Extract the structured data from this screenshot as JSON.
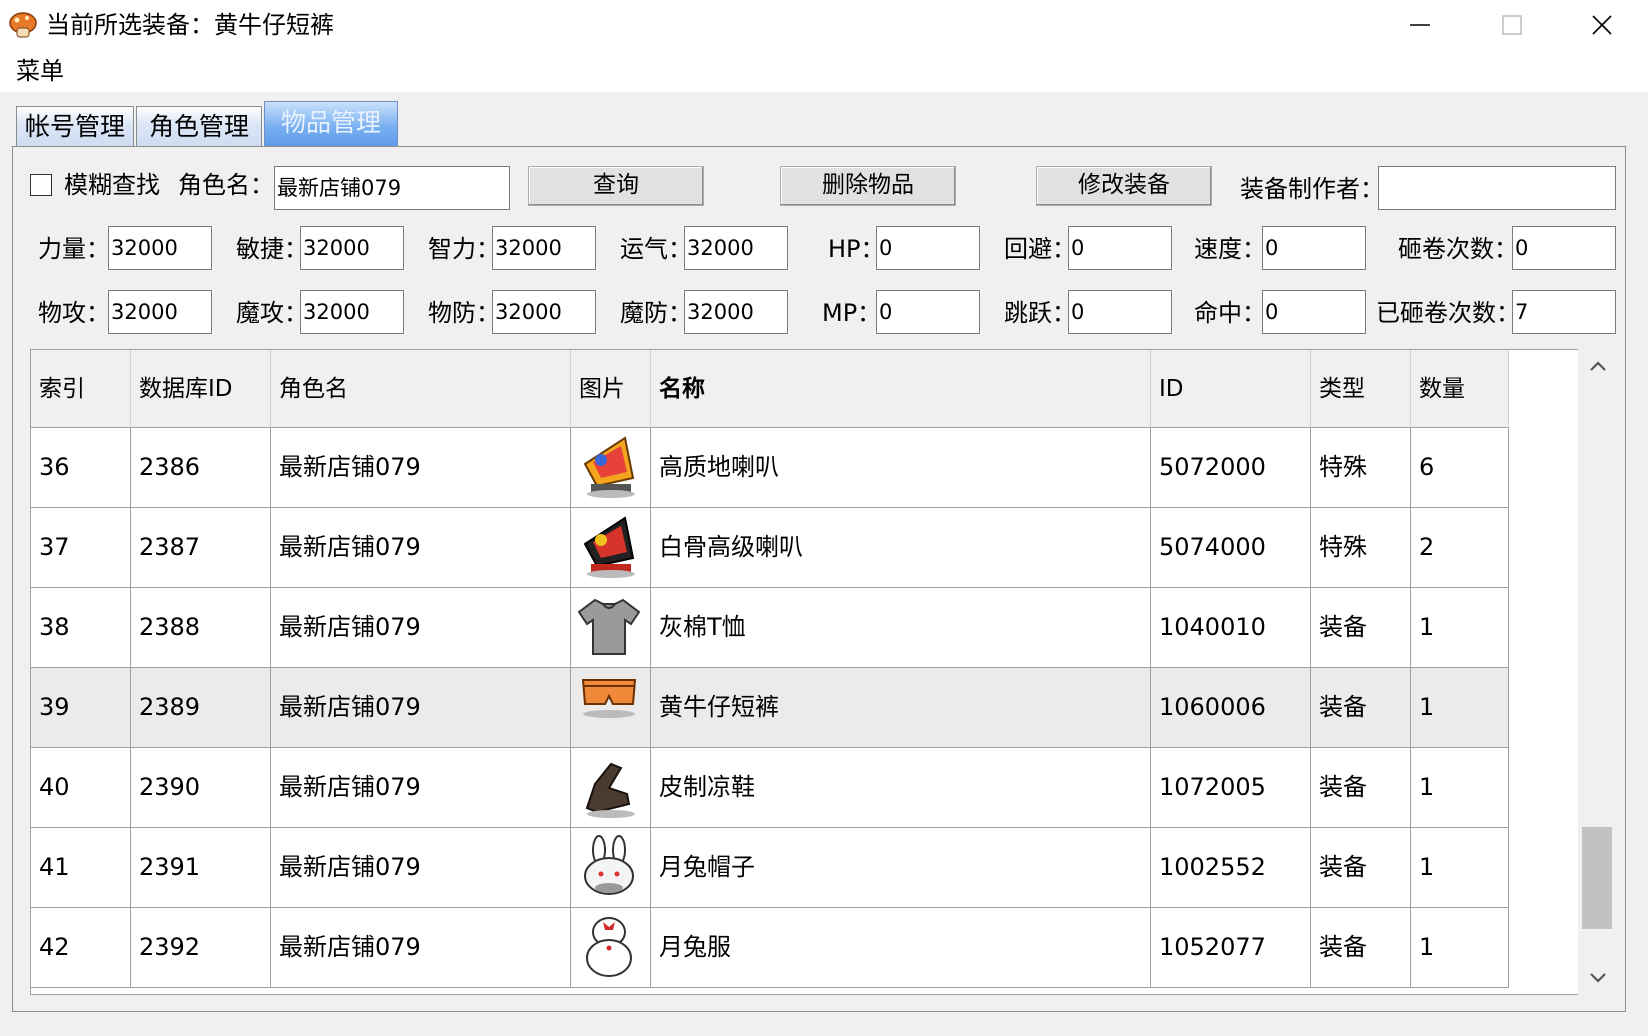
{
  "window": {
    "title": "当前所选装备：黄牛仔短裤",
    "menu": "菜单"
  },
  "tabs": [
    {
      "label": "帐号管理",
      "active": false
    },
    {
      "label": "角色管理",
      "active": false
    },
    {
      "label": "物品管理",
      "active": true
    }
  ],
  "search": {
    "fuzzy_label": "模糊查找",
    "fuzzy_checked": false,
    "role_label": "角色名：",
    "role_value": "最新店铺079",
    "query_button": "查询",
    "delete_button": "删除物品",
    "modify_button": "修改装备",
    "maker_label": "装备制作者：",
    "maker_value": ""
  },
  "stats": {
    "str": {
      "label": "力量：",
      "value": "32000"
    },
    "dex": {
      "label": "敏捷：",
      "value": "32000"
    },
    "int": {
      "label": "智力：",
      "value": "32000"
    },
    "luk": {
      "label": "运气：",
      "value": "32000"
    },
    "hp": {
      "label": "HP：",
      "value": "0"
    },
    "avoid": {
      "label": "回避：",
      "value": "0"
    },
    "speed": {
      "label": "速度：",
      "value": "0"
    },
    "scroll_slots": {
      "label": "砸卷次数：",
      "value": "0"
    },
    "watk": {
      "label": "物攻：",
      "value": "32000"
    },
    "matk": {
      "label": "魔攻：",
      "value": "32000"
    },
    "wdef": {
      "label": "物防：",
      "value": "32000"
    },
    "mdef": {
      "label": "魔防：",
      "value": "32000"
    },
    "mp": {
      "label": "MP：",
      "value": "0"
    },
    "jump": {
      "label": "跳跃：",
      "value": "0"
    },
    "acc": {
      "label": "命中：",
      "value": "0"
    },
    "scrolled": {
      "label": "已砸卷次数：",
      "value": "7"
    }
  },
  "table": {
    "columns": [
      "索引",
      "数据库ID",
      "角色名",
      "图片",
      "名称",
      "ID",
      "类型",
      "数量"
    ],
    "rows": [
      {
        "index": "36",
        "dbid": "2386",
        "role": "最新店铺079",
        "icon": "megaphone-gold-icon",
        "name": "高质地喇叭",
        "id": "5072000",
        "type": "特殊",
        "qty": "6",
        "selected": false
      },
      {
        "index": "37",
        "dbid": "2387",
        "role": "最新店铺079",
        "icon": "megaphone-black-icon",
        "name": "白骨高级喇叭",
        "id": "5074000",
        "type": "特殊",
        "qty": "2",
        "selected": false
      },
      {
        "index": "38",
        "dbid": "2388",
        "role": "最新店铺079",
        "icon": "gray-tshirt-icon",
        "name": "灰棉T恤",
        "id": "1040010",
        "type": "装备",
        "qty": "1",
        "selected": false
      },
      {
        "index": "39",
        "dbid": "2389",
        "role": "最新店铺079",
        "icon": "orange-shorts-icon",
        "name": "黄牛仔短裤",
        "id": "1060006",
        "type": "装备",
        "qty": "1",
        "selected": true
      },
      {
        "index": "40",
        "dbid": "2390",
        "role": "最新店铺079",
        "icon": "leather-sandal-icon",
        "name": "皮制凉鞋",
        "id": "1072005",
        "type": "装备",
        "qty": "1",
        "selected": false
      },
      {
        "index": "41",
        "dbid": "2391",
        "role": "最新店铺079",
        "icon": "bunny-hat-icon",
        "name": "月兔帽子",
        "id": "1002552",
        "type": "装备",
        "qty": "1",
        "selected": false
      },
      {
        "index": "42",
        "dbid": "2392",
        "role": "最新店铺079",
        "icon": "bunny-suit-icon",
        "name": "月兔服",
        "id": "1052077",
        "type": "装备",
        "qty": "1",
        "selected": false
      }
    ]
  }
}
